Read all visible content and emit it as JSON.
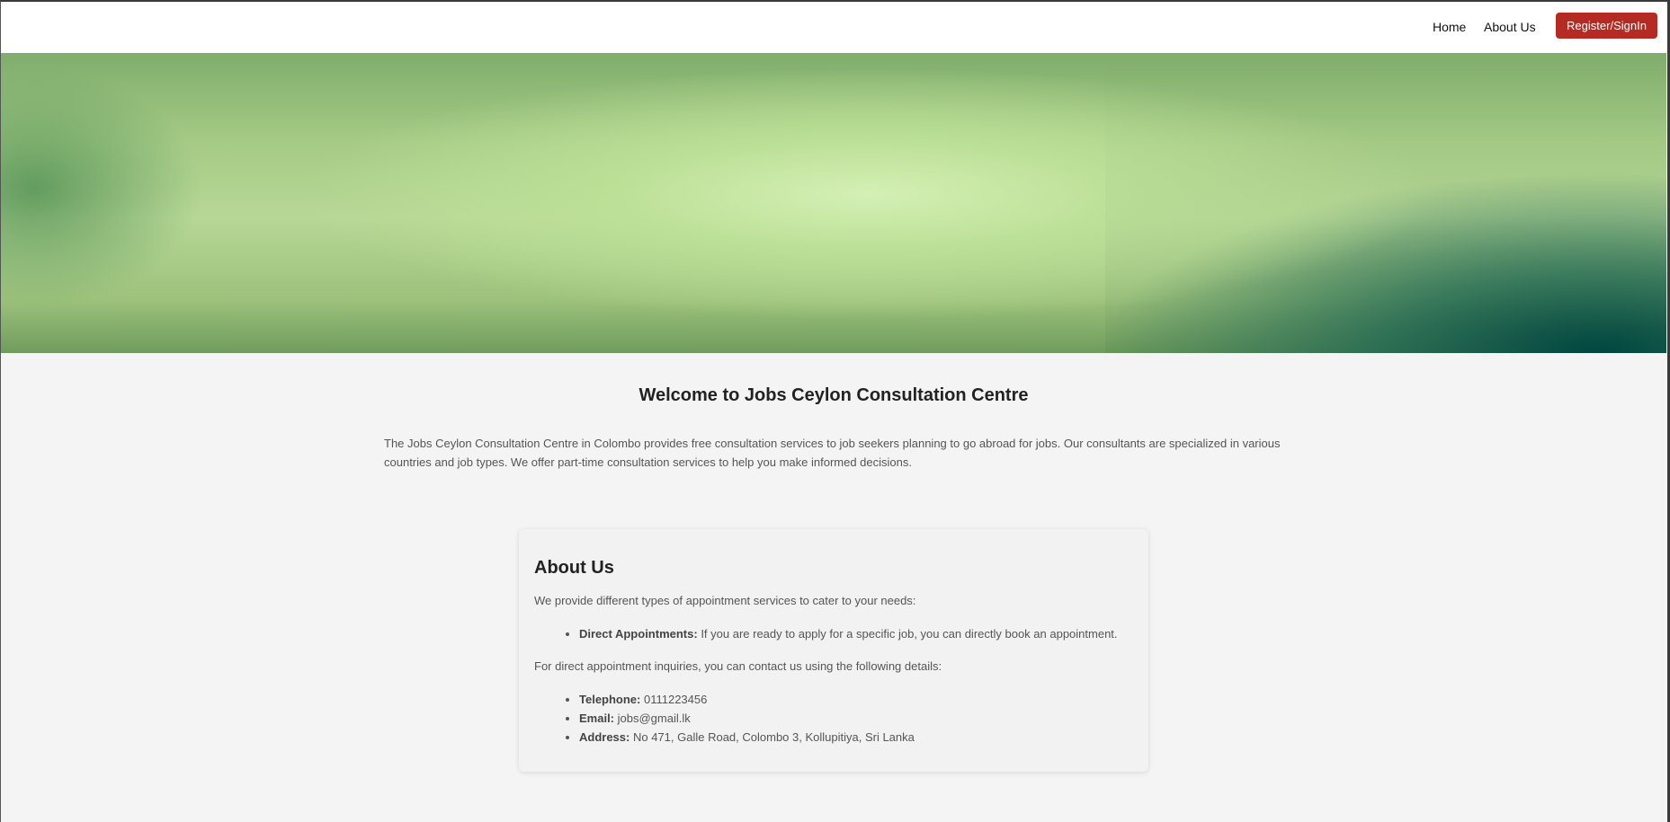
{
  "nav": {
    "home": "Home",
    "about": "About Us",
    "register": "Register/SignIn"
  },
  "welcome": {
    "title": "Welcome to Jobs Ceylon Consultation Centre",
    "intro": "The Jobs Ceylon Consultation Centre in Colombo provides free consultation services to job seekers planning to go abroad for jobs. Our consultants are specialized in various countries and job types. We offer part-time consultation services to help you make informed decisions."
  },
  "about": {
    "title": "About Us",
    "services_intro": "We provide different types of appointment services to cater to your needs:",
    "services": [
      {
        "label": "Direct Appointments:",
        "text": " If you are ready to apply for a specific job, you can directly book an appointment."
      }
    ],
    "contact_intro": "For direct appointment inquiries, you can contact us using the following details:",
    "contacts": [
      {
        "label": "Telephone:",
        "text": " 0111223456"
      },
      {
        "label": "Email:",
        "text": " jobs@gmail.lk"
      },
      {
        "label": "Address:",
        "text": " No 471, Galle Road, Colombo 3, Kollupitiya, Sri Lanka"
      }
    ]
  },
  "colors": {
    "accent": "#b52b23",
    "page_bg": "#f4f4f4"
  }
}
